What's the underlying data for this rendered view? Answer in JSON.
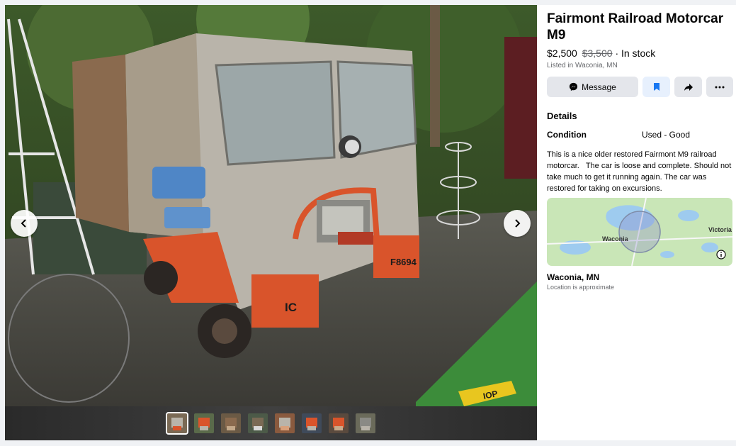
{
  "listing": {
    "title": "Fairmont Railroad Motorcar M9",
    "price": "$2,500",
    "original_price": "$3,500",
    "availability": "· In stock",
    "listed_in": "Listed in Waconia, MN"
  },
  "actions": {
    "message_label": "Message"
  },
  "details": {
    "heading": "Details",
    "condition_label": "Condition",
    "condition_value": "Used - Good",
    "description": "This is a nice older restored Fairmont M9 railroad motorcar.   The car is loose and complete. Should not take much to get it running again. The car was restored for taking on excursions."
  },
  "map": {
    "town_label": "Waconia",
    "nearby_label": "Victoria"
  },
  "location": {
    "name": "Waconia, MN",
    "note": "Location is approximate"
  },
  "photo": {
    "car_number": "F8694",
    "car_lettering": "IC",
    "bin_lettering": "IOP"
  },
  "gallery": {
    "thumbnail_count": 8,
    "active_index": 0
  },
  "colors": {
    "accent": "#1877f2",
    "car_orange": "#d9542b",
    "map_water": "#9ecbef",
    "map_land": "#c9e6b7"
  },
  "icons": [
    "chevron-left-icon",
    "chevron-right-icon",
    "messenger-icon",
    "bookmark-icon",
    "share-icon",
    "more-icon",
    "info-icon"
  ]
}
